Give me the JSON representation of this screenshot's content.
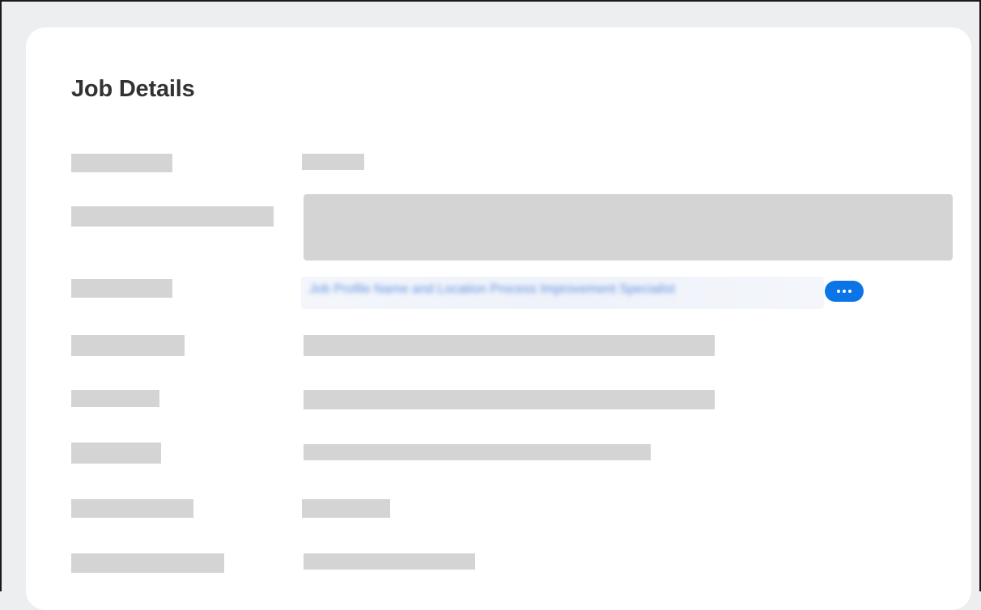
{
  "card": {
    "title": "Job Details"
  },
  "job_link": {
    "text": "Job Profile Name and Location Process Improvement Specialist"
  },
  "icons": {
    "more_actions": "ellipsis-icon"
  },
  "colors": {
    "page_background": "#edeef0",
    "card_background": "#ffffff",
    "title_text": "#333333",
    "skeleton": "#d4d4d4",
    "accent_blue": "#0b74e6"
  }
}
